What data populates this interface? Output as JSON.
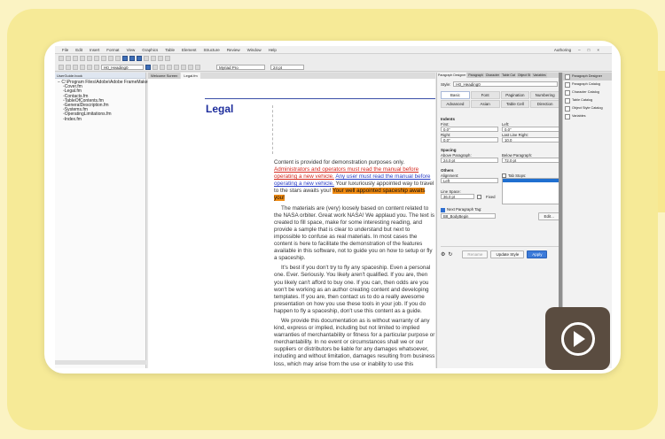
{
  "menubar": {
    "items": [
      "File",
      "Edit",
      "Insert",
      "Format",
      "View",
      "Graphics",
      "Table",
      "Element",
      "Structure",
      "Review",
      "Window",
      "Help"
    ],
    "workspace": "Authoring"
  },
  "toolbar": {
    "paragraph_style": "H0_Heading0",
    "font": "Myriad Pro",
    "size": "24 pt"
  },
  "left_panel": {
    "title": "UserGuide.book",
    "tree": [
      "C:\\Program Files\\Adobe\\Adobe FrameMaker 202",
      "Cover.fm",
      "Legal.fm",
      "Contacts.fm",
      "TableOfContents.fm",
      "GeneralDescription.fm",
      "Systems.fm",
      "OperatingLimitations.fm",
      "Index.fm"
    ]
  },
  "document": {
    "tabs": [
      "Welcome Screen",
      "Legal.fm"
    ],
    "heading": "Legal",
    "p1_plain": "Content is provided for demonstration purposes only. ",
    "p1_red": "Administrators and operators must read the manual before operating a new vehicle.",
    "p1_space": " ",
    "p1_blue": "Any user must read the manual before operating a new vehicle.",
    "p1_after": " Your luxuriously appointed way to travel to the stars awaits you! ",
    "p1_highlight": "Your well appointed spaceship awaits you!",
    "p2": "The materials are (very) loosely based on content related to the NASA orbiter. Great work NASA! We applaud you. The text is created to fill space, make for some interesting reading, and provide a sample that is clear to understand but next to impossible to confuse as real materials. In most cases the content is here to facilitate the demonstration of the features available in this software, not to guide you on how to setup or fly a spaceship.",
    "p3": "It's best if you don't try to fly any spaceship. Even a personal one. Ever. Seriously. You likely aren't qualified. If you are, then you likely can't afford to buy one. If you can, then odds are you won't be working as an author creating content and developing templates. If you are, then contact us to do a really awesome presentation on how you use these tools in your job. If you do happen to fly a spaceship, don't use this content as a guide.",
    "p4": "We provide this documentation as is without warranty of any kind, express or implied, including but not limited to implied warranties of merchantability or fitness for a particular purpose or merchantability. In no event or circumstances shall we or our suppliers or distributors be liable for any damages whatsoever, including and without limitation, damages resulting from business loss, which may arise from the use or inability to use this documentation."
  },
  "para_designer": {
    "tabs": [
      "Paragraph Designer",
      "Paragraph",
      "Character",
      "Table Cat",
      "Object St",
      "Variables"
    ],
    "style_label": "Style:",
    "style_value": "H0_Heading0",
    "subtabs": [
      "Basic",
      "Font",
      "Pagination",
      "Numbering",
      "Advanced",
      "Asian",
      "Table Cell",
      "Direction"
    ],
    "indents_title": "Indents",
    "first_label": "First:",
    "first_value": "0.0\"",
    "left_label": "Left:",
    "left_value": "0.0\"",
    "right_label": "Right:",
    "right_value": "0.0\"",
    "last_line_label": "Last Line Right:",
    "last_line_value": "10.0",
    "spacing_title": "Spacing",
    "above_label": "Above Paragraph:",
    "above_value": "24.0 pt",
    "below_label": "Below Paragraph:",
    "below_value": "72.0 pt",
    "others_title": "Others",
    "alignment_label": "Alignment:",
    "alignment_value": "Left",
    "tab_stops_label": "Tab Stops:",
    "line_space_label": "Line Space:",
    "line_space_value": "36.0 pt",
    "fixed_label": "Fixed",
    "next_tag_label": "Next Paragraph Tag:",
    "next_tag_value": "B8_BodyBegin",
    "edit_label": "Edit...",
    "rename_label": "Rename",
    "update_label": "Update Style",
    "apply_label": "Apply"
  },
  "side_panel": {
    "items": [
      "Paragraph Designer",
      "Paragraph Catalog",
      "Character Catalog",
      "Table Catalog",
      "Object Style Catalog",
      "Variables"
    ]
  },
  "colors": {
    "accent_blue": "#1d2d9c",
    "highlight_orange": "#f08a10",
    "link_red": "#d4281e",
    "play_bg": "#5a4c40"
  }
}
